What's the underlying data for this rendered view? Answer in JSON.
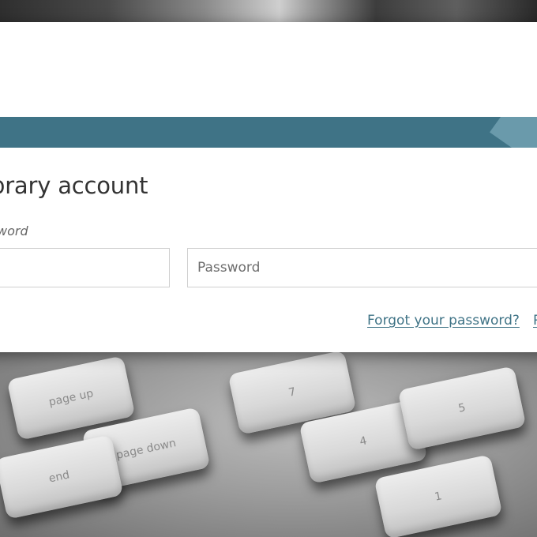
{
  "login": {
    "heading": "brary account",
    "field_label": "word",
    "username_placeholder": "",
    "password_placeholder": "Password",
    "forgot_link": "Forgot your password?",
    "second_link": "R"
  },
  "background": {
    "keys": [
      "page up",
      "page down",
      "end",
      "7",
      "4",
      "5",
      "1"
    ]
  },
  "colors": {
    "banner": "#3f7386",
    "banner_accent": "#6a9aab",
    "link": "#3f7386"
  }
}
